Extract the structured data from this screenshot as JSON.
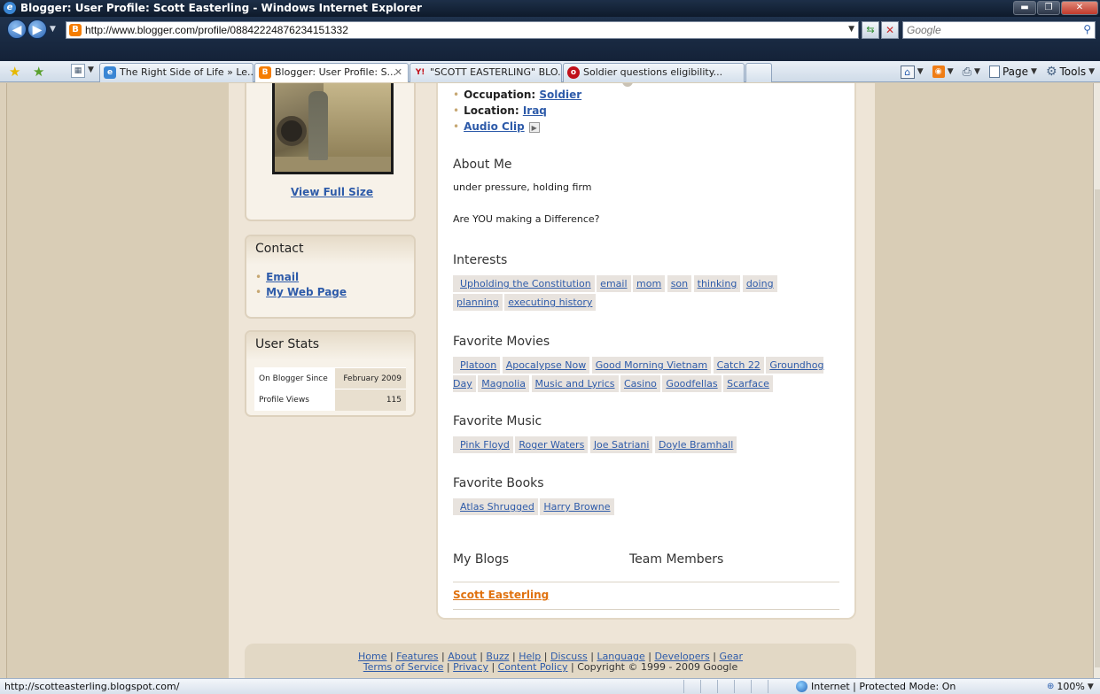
{
  "window": {
    "title": "Blogger: User Profile: Scott Easterling - Windows Internet Explorer"
  },
  "address_bar": {
    "url": "http://www.blogger.com/profile/08842224876234151332",
    "search_placeholder": "Google"
  },
  "tabs": [
    {
      "label": "The Right Side of Life » Le...",
      "icon": "ie-icon",
      "active": false
    },
    {
      "label": "Blogger: User Profile: S...",
      "icon": "blogger-icon",
      "active": true
    },
    {
      "label": "\"SCOTT EASTERLING\" BLO...",
      "icon": "yahoo-icon",
      "active": false
    },
    {
      "label": "Soldier questions eligibility...",
      "icon": "news-icon",
      "active": false
    }
  ],
  "command_bar": {
    "page_label": "Page",
    "tools_label": "Tools"
  },
  "profile": {
    "view_full_size": "View Full Size",
    "info": [
      {
        "label": "Occupation:",
        "value": "Soldier"
      },
      {
        "label": "Location:",
        "value": "Iraq"
      },
      {
        "label": "",
        "value": "Audio Clip"
      }
    ]
  },
  "contact": {
    "heading": "Contact",
    "links": [
      "Email",
      "My Web Page"
    ]
  },
  "user_stats": {
    "heading": "User Stats",
    "rows": [
      {
        "label": "On Blogger Since",
        "value": "February 2009"
      },
      {
        "label": "Profile Views",
        "value": "115"
      }
    ]
  },
  "about": {
    "heading": "About Me",
    "line1": "under pressure, holding firm",
    "line2": "Are YOU making a Difference?"
  },
  "interests": {
    "heading": "Interests",
    "items": [
      "Upholding the Constitution",
      "email",
      "mom",
      "son",
      "thinking",
      "doing",
      "planning",
      "executing history"
    ]
  },
  "movies": {
    "heading": "Favorite Movies",
    "items": [
      "Platoon",
      "Apocalypse Now",
      "Good Morning Vietnam",
      "Catch 22",
      "Groundhog Day",
      "Magnolia",
      "Music and Lyrics",
      "Casino",
      "Goodfellas",
      "Scarface"
    ]
  },
  "music": {
    "heading": "Favorite Music",
    "items": [
      "Pink Floyd",
      "Roger Waters",
      "Joe Satriani",
      "Doyle Bramhall"
    ]
  },
  "books": {
    "heading": "Favorite Books",
    "items": [
      "Atlas Shrugged",
      "Harry Browne"
    ]
  },
  "blogs": {
    "heading": "My Blogs",
    "team_heading": "Team Members",
    "blog_link": "Scott Easterling"
  },
  "footer": {
    "links_line1": [
      "Home",
      "Features",
      "About",
      "Buzz",
      "Help",
      "Discuss",
      "Language",
      "Developers",
      "Gear"
    ],
    "terms": "Terms of Service",
    "privacy": "Privacy",
    "content_policy": "Content Policy",
    "copyright": "Copyright © 1999 - 2009 Google"
  },
  "status_bar": {
    "url": "http://scotteasterling.blogspot.com/",
    "zone": "Internet | Protected Mode: On",
    "zoom": "100%"
  }
}
